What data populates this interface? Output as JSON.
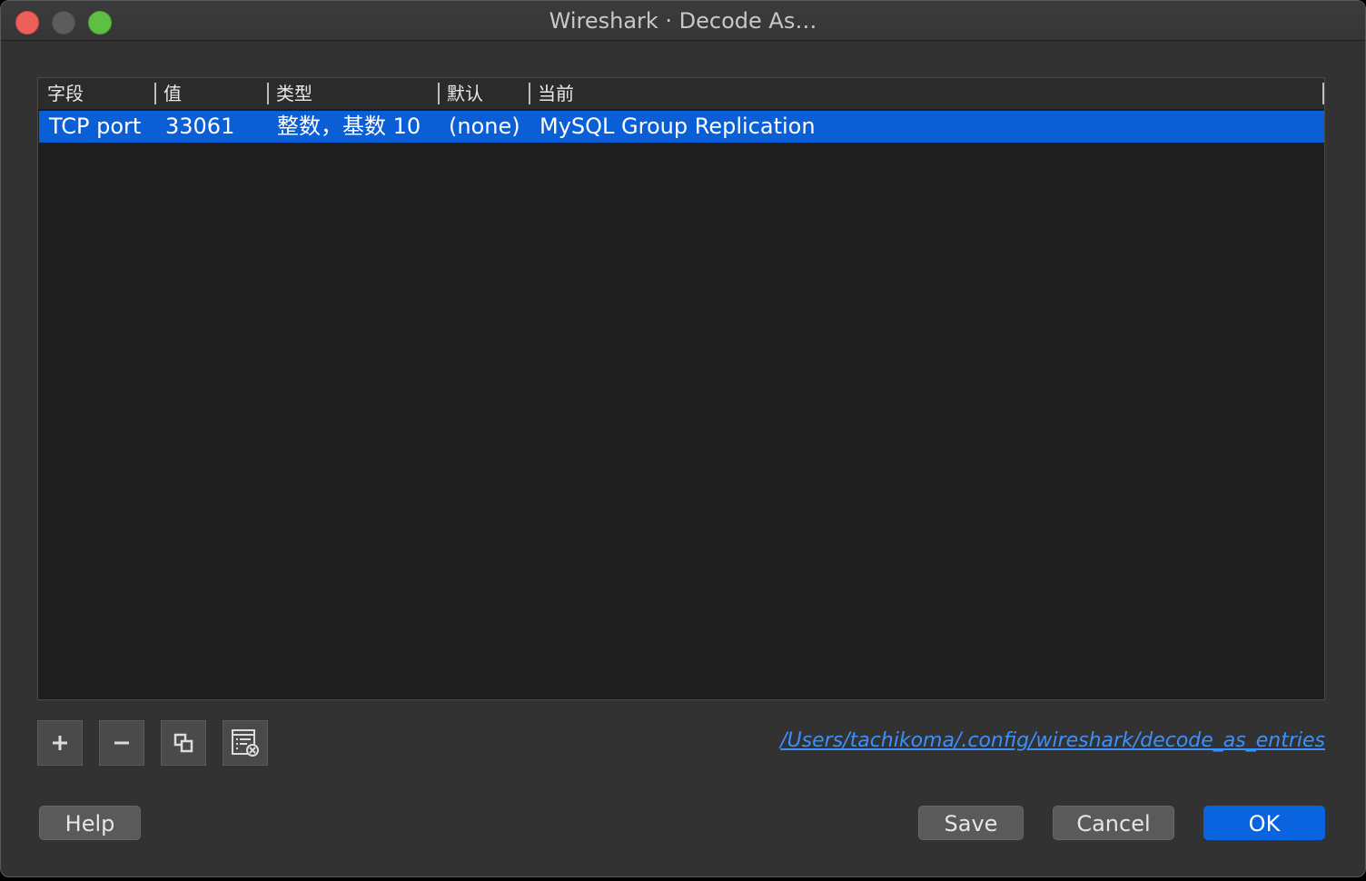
{
  "window": {
    "title": "Wireshark · Decode As…"
  },
  "table": {
    "columns": [
      "字段",
      "值",
      "类型",
      "默认",
      "当前"
    ],
    "rows": [
      {
        "field": "TCP port",
        "value": "33061",
        "type": "整数，基数 10",
        "default": "(none)",
        "current": "MySQL Group Replication",
        "selected": true
      }
    ]
  },
  "toolbar": {
    "add_icon": "plus-icon",
    "remove_icon": "minus-icon",
    "copy_icon": "copy-icon",
    "clear_icon": "clear-list-icon"
  },
  "config_path": "/Users/tachikoma/.config/wireshark/decode_as_entries",
  "buttons": {
    "help": "Help",
    "save": "Save",
    "cancel": "Cancel",
    "ok": "OK"
  },
  "colors": {
    "selection": "#0a5ed6",
    "accent": "#0a64e0",
    "link": "#3a90ff"
  }
}
